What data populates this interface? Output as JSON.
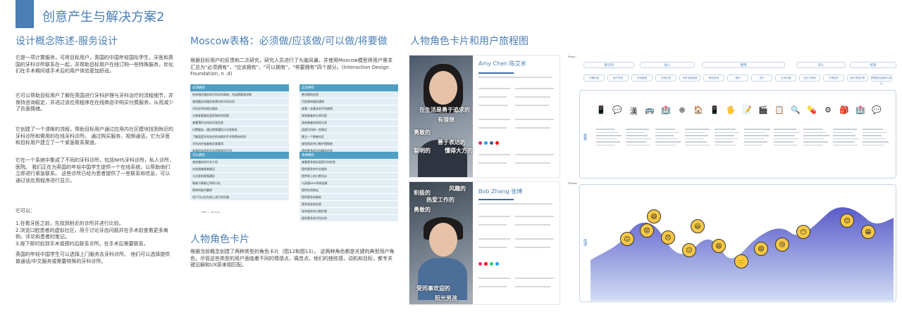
{
  "header": {
    "title": "创意产生与解决方案2"
  },
  "section1": {
    "title": "设计概念陈述-服务设计",
    "paragraphs": [
      "它是一项计算服务，可将目标用户，英国的中国年轻国际学生，牙医和英国的牙科诊所联系在一起，并帮助目标用户在线订购一些特殊服务，优化们在手术期间或手术后的用户体验更加舒适。",
      "它可以帮助目标用户了解在英国进行牙科护理与牙科治疗的流程细节，并保持咨询稳定，并进过该应用程序在在线商店中购买付费服务，从而减少了负面情绪。",
      "它创建了一个清晰的流程，帮助目标用户通过应用内社区模块找到附近的牙科诊所和需用的在线牙科诊所。 通过购买服务，视频通话，它为牙医和目标用户建立了一个紧急联系渠道。",
      "它在一个系统中集成了不同的牙科诊所，包括NHS牙科诊所，私人诊所，医院。 我们正在为英国的年轻中国学生提供一个在线系统，以帮助他们立即进行紧急联系。 这些诊所已经为患者提供了一些联系和信息，可以通过该应用程序进行显示。",
      "它可以：",
      "1.在看牙医之前，先找到附近的诊所并进行比较。\n2.浏览口腔患者的虚拟社区，用于讨论牙齿问题并在手术前查看更多病例，评论和患者的笔记。\n3.按下即时前到手术或预约后联系诊所。在手术后需要联系。",
      "英国的年轻中国学生可以选择上门服务去牙科诊所。 他们可以选择提供普通话/中文服务或需要特殊的牙科诊所。"
    ]
  },
  "section2": {
    "title": "Moscow表格：必须做/应该做/可以做/将要做",
    "intro": "根据目标用户的反馈和二次研究，研究人员进行了头脑风暴，并使用Moscow模型将用户需求汇总为\"必须拥有\"，\"应该拥有\"，\"可以拥有\"，\"将要拥有\"四个部分。(Interaction Design Foundation, n .d)",
    "must_header": "必须拥有",
    "must_items": [
      "给有相应服务的牙科诊所清单，包括数据和详细",
      "查找最近的服务和预约的牙科诊所",
      "牙科诊所的就诊服务",
      "方便查看服务类型和的时间表",
      "查看预约诊所的牙医信息",
      "付费服务，通过视频通话与牙医联系",
      "了解英国牙科治疗的流程的手术和等待时间",
      "牙科治疗准备和注意事项",
      "准备相关的医学术语和常用手语"
    ],
    "should_header": "应该拥有",
    "should_items": [
      "更详细的信息",
      "可定制的服务通知",
      "查看一些基本的牙科病例",
      "其他患者的分享内容",
      "其他患者的经验分享",
      "英国牙科的一些情况",
      "建立一个患者社区",
      "查找相关的口腔护理指南",
      "提供更多的牙科服务信息",
      "其他患者的讨论"
    ],
    "could_header": "可以拥有",
    "could_items": [
      "其他服务的中文介绍",
      "在线调查患者情况",
      "与牙医的视频通话",
      "患者与患者之间的讨论",
      "简单的医疗翻译",
      "用户可以在在线上进行的沟通"
    ],
    "wont_header": "将要拥有",
    "wont_items": [
      "查看更多相关英国牙科信息",
      "提供更多的中文服务",
      "提供线上的口腔问诊",
      "与英国NHS系统连接",
      "提供在线商店",
      "提供更多的服务",
      "更多相关的信息",
      "发布相关的口腔护理",
      "提供更多的牙科诊所"
    ],
    "caption": "Table 1 - Moscow",
    "persona_title": "人物角色卡片",
    "persona_intro": "根据当前概念创建了两种类型的角色卡片（图12和图13）。 这两种角色都是关键的典型用户角色，尽管这些类型的用户面临着不同的情感点，痛苦点。他们的挫败感，动机和目标，都专关键见解和UX原来相匹配。"
  },
  "section3": {
    "title": "人物角色卡片和用户旅程图",
    "persona1": {
      "name": "Amy Chen 陈艾米",
      "quotes": [
        "勇敢的",
        "聪明的",
        "善于表达的",
        "懂得大方的",
        "在生活是勇于追求的",
        "有理想"
      ]
    },
    "persona2": {
      "name": "Bob Zhang 张博",
      "quotes": [
        "风趣的",
        "积极的",
        "勇敢的",
        "热爱工作的",
        "受同事欢迎的",
        "阳光男孩"
      ]
    },
    "journey": {
      "persona_label": "Perso",
      "phases": [
        "意识到",
        "加入",
        "使用",
        "深入",
        "结束"
      ],
      "steps": [
        "牙痛开始",
        "用户选择",
        "在线搜索",
        "在线比较",
        "诊所详细信息",
        "聊天咨询",
        "预约",
        "支付",
        "交流沟通",
        "治疗与其他",
        "分享经历",
        "医疗体验分享",
        "获取售后服务与评价"
      ],
      "row_label_steps": "旅程",
      "row_label_emotion": "情绪",
      "emotion_label": "Person",
      "icons": [
        "📱",
        "💬",
        "漢",
        "🚌",
        "🏥",
        "⊕",
        "🏠",
        "📱",
        "🖐",
        "📝",
        "🎬",
        "📋",
        "🔍",
        "💊",
        "⚙",
        "🎒",
        "🏥",
        "💬"
      ],
      "emojis": [
        "😐",
        "😟",
        "😄",
        "😞",
        "😐",
        "😃",
        "😆",
        "🙂",
        "😄",
        "😢",
        "😶",
        "😊",
        "😁"
      ],
      "colors": {
        "wave_top": "#3d3fbf",
        "wave_bottom": "#c8d7f3",
        "accent": "#4a7eb5"
      }
    }
  }
}
